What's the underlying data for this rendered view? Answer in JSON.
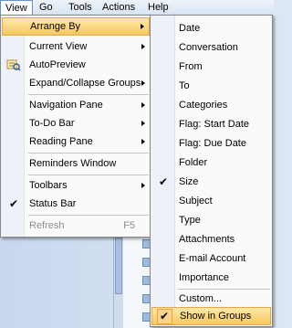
{
  "menubar": {
    "items": [
      "View",
      "Go",
      "Tools",
      "Actions",
      "Help"
    ]
  },
  "view_menu": {
    "items": [
      {
        "label": "Arrange By",
        "submenu": true,
        "highlighted": true
      },
      {
        "label": "Current View",
        "submenu": true
      },
      {
        "label": "AutoPreview",
        "icon": "autopreview-icon"
      },
      {
        "label": "Expand/Collapse Groups",
        "submenu": true
      },
      {
        "label": "Navigation Pane",
        "submenu": true
      },
      {
        "label": "To-Do Bar",
        "submenu": true
      },
      {
        "label": "Reading Pane",
        "submenu": true
      },
      {
        "label": "Reminders Window"
      },
      {
        "label": "Toolbars",
        "submenu": true
      },
      {
        "label": "Status Bar",
        "checked": true
      },
      {
        "label": "Refresh",
        "shortcut": "F5",
        "disabled": true
      }
    ]
  },
  "arrange_menu": {
    "items": [
      {
        "label": "Date"
      },
      {
        "label": "Conversation"
      },
      {
        "label": "From"
      },
      {
        "label": "To"
      },
      {
        "label": "Categories"
      },
      {
        "label": "Flag: Start Date"
      },
      {
        "label": "Flag: Due Date"
      },
      {
        "label": "Folder"
      },
      {
        "label": "Size",
        "checked": true
      },
      {
        "label": "Subject"
      },
      {
        "label": "Type"
      },
      {
        "label": "Attachments"
      },
      {
        "label": "E-mail Account"
      },
      {
        "label": "Importance"
      },
      {
        "label": "Custom..."
      },
      {
        "label": "Show in Groups",
        "checked": true,
        "highlighted": true
      }
    ]
  },
  "colors": {
    "highlight": "#f8c860",
    "menubar": "#d7e3f2",
    "checkbox": "#fcd38a"
  }
}
